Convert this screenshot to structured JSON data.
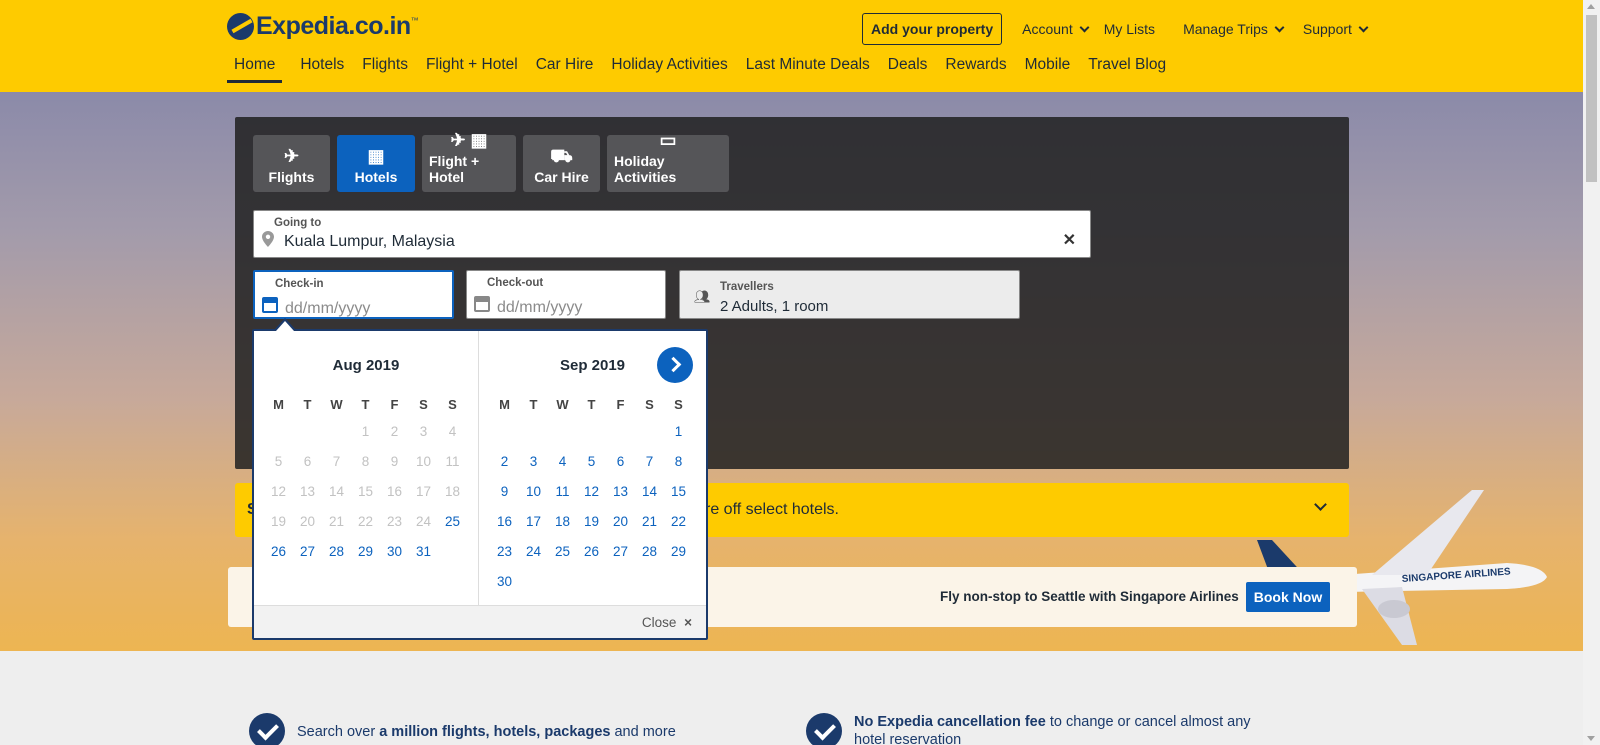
{
  "header": {
    "logo_text": "Expedia.co.in",
    "logo_tm": "™",
    "add_property": "Add your property",
    "account": "Account",
    "my_lists": "My Lists",
    "manage_trips": "Manage Trips",
    "support": "Support",
    "nav": [
      "Home",
      "Hotels",
      "Flights",
      "Flight + Hotel",
      "Car Hire",
      "Holiday Activities",
      "Last Minute Deals",
      "Deals",
      "Rewards",
      "Mobile",
      "Travel Blog"
    ]
  },
  "search": {
    "tabs": [
      {
        "label": "Flights",
        "icon": "airplane-icon"
      },
      {
        "label": "Hotels",
        "icon": "hotel-building-icon"
      },
      {
        "label": "Flight + Hotel",
        "icon": "flight-hotel-icon"
      },
      {
        "label": "Car Hire",
        "icon": "car-icon"
      },
      {
        "label": "Holiday Activities",
        "icon": "ticket-icon"
      }
    ],
    "going_to_label": "Going to",
    "going_to_value": "Kuala Lumpur, Malaysia",
    "checkin_label": "Check-in",
    "checkin_placeholder": "dd/mm/yyyy",
    "checkout_label": "Check-out",
    "checkout_placeholder": "dd/mm/yyyy",
    "travellers_label": "Travellers",
    "travellers_value": "2 Adults, 1 room"
  },
  "calendar": {
    "dow": [
      "M",
      "T",
      "W",
      "T",
      "F",
      "S",
      "S"
    ],
    "months": [
      {
        "title": "Aug 2019",
        "offset": 3,
        "days": 31,
        "first_available": 25
      },
      {
        "title": "Sep 2019",
        "offset": 6,
        "days": 30,
        "first_available": 1
      }
    ],
    "close_label": "Close",
    "close_icon": "×"
  },
  "promo": {
    "first_char": "S",
    "text": "re off select hotels."
  },
  "ad": {
    "text": "Fly non-stop to Seattle with Singapore Airlines",
    "button": "Book Now"
  },
  "features": [
    {
      "pre": "Search over ",
      "bold": "a million flights, hotels, packages",
      "post": " and more"
    },
    {
      "pre": "",
      "bold": "No Expedia cancellation fee",
      "post": " to change or cancel almost any hotel reservation"
    }
  ],
  "colors": {
    "brand_yellow": "#fecb00",
    "brand_navy": "#1b3a6b",
    "accent_blue": "#0c62be"
  }
}
